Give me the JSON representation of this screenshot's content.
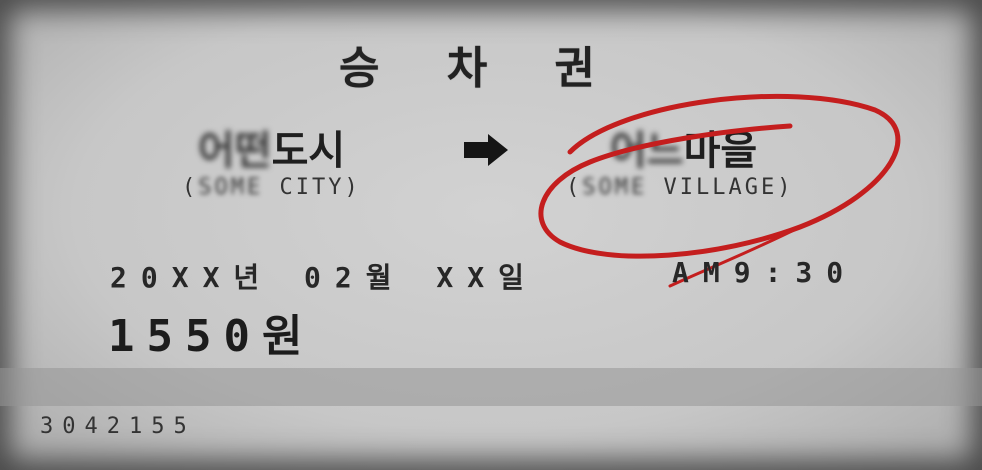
{
  "ticket": {
    "title": "승 차 권",
    "from": {
      "name_hidden": "어떤",
      "name_visible": "도시",
      "en_prefix": "(",
      "en_hidden": "SOME",
      "en_visible": " CITY)"
    },
    "to": {
      "name_hidden": "어느",
      "name_visible": "마을",
      "en_prefix": "(",
      "en_hidden": "SOME",
      "en_visible": " VILLAGE)"
    },
    "date": "20XX년 02월 XX일",
    "time": "AM9:30",
    "price": "1550원",
    "serial": "3042155"
  },
  "colors": {
    "paper": "#cdcdcd",
    "ink": "#1d1d1d",
    "annotation_red": "#c41e1e"
  },
  "icons": {
    "arrow": "right-arrow-icon"
  }
}
